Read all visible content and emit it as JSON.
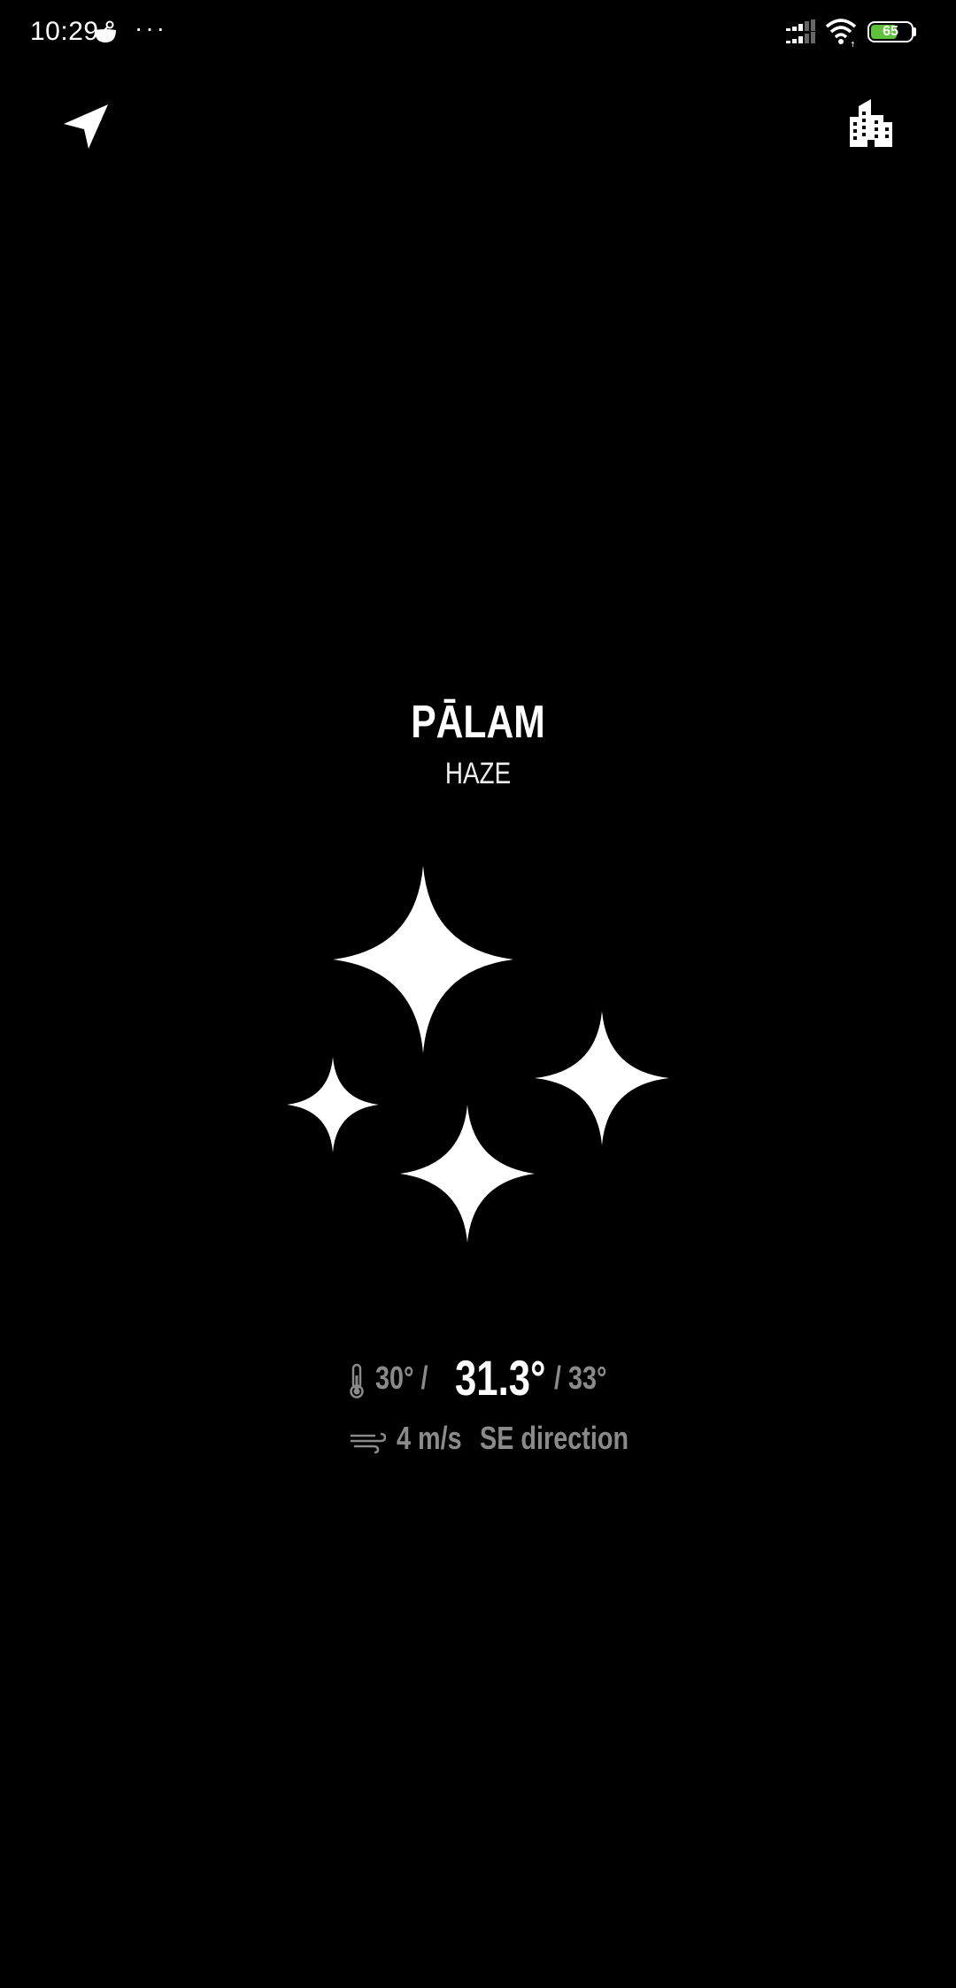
{
  "status_bar": {
    "time": "10:29",
    "more_indicator": "···",
    "battery_level": "65",
    "battery_fraction": 0.65,
    "battery_color": "#5fc23a",
    "icons": [
      "app-notification-icon",
      "signal-icon",
      "wifi-icon",
      "battery-icon"
    ]
  },
  "toolbar": {
    "location_icon": "navigation-arrow-icon",
    "city_icon": "city-buildings-icon"
  },
  "weather": {
    "place": "PĀLAM",
    "condition": "HAZE",
    "illustration_icon": "haze-sparkles-icon",
    "temp_min": "30° /",
    "temp_current": "31.3°",
    "temp_max": "/ 33°",
    "wind_speed": "4 m/s",
    "wind_direction": "SE direction"
  },
  "colors": {
    "background": "#000000",
    "primary_text": "#ffffff",
    "secondary_text": "#8a8a8a"
  }
}
